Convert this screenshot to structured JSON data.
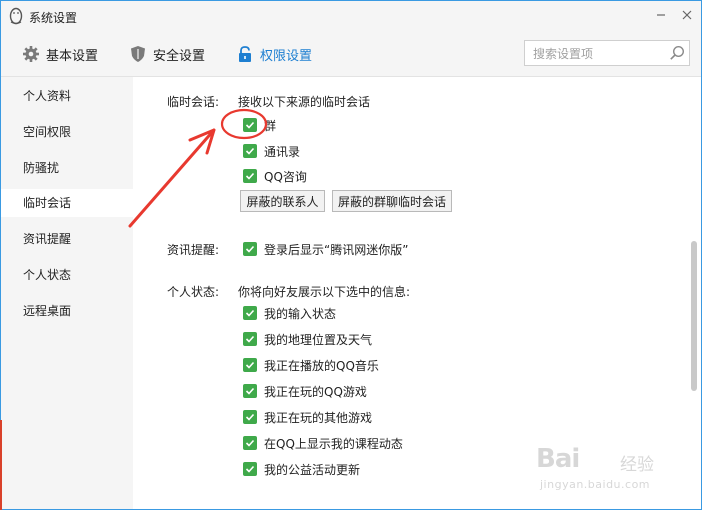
{
  "window": {
    "title": "系统设置",
    "icons": {
      "logo": "penguin-icon",
      "minimize": "minimize-icon",
      "close": "close-icon"
    }
  },
  "toolbar": {
    "tabs": [
      {
        "label": "基本设置",
        "icon": "gear-icon",
        "active": false
      },
      {
        "label": "安全设置",
        "icon": "shield-icon",
        "active": false
      },
      {
        "label": "权限设置",
        "icon": "lock-icon",
        "active": true
      }
    ],
    "search": {
      "placeholder": "搜索设置项",
      "value": "",
      "icon": "search-icon"
    },
    "accent_color": "#1e7fd1"
  },
  "sidebar": {
    "items": [
      {
        "label": "个人资料",
        "active": false
      },
      {
        "label": "空间权限",
        "active": false
      },
      {
        "label": "防骚扰",
        "active": false
      },
      {
        "label": "临时会话",
        "active": true
      },
      {
        "label": "资讯提醒",
        "active": false
      },
      {
        "label": "个人状态",
        "active": false
      },
      {
        "label": "远程桌面",
        "active": false
      }
    ]
  },
  "main": {
    "temp_session": {
      "label": "临时会话:",
      "description": "接收以下来源的临时会话",
      "options": [
        {
          "label": "群",
          "checked": true
        },
        {
          "label": "通讯录",
          "checked": true
        },
        {
          "label": "QQ咨询",
          "checked": true
        }
      ],
      "buttons": [
        "屏蔽的联系人",
        "屏蔽的群聊临时会话"
      ]
    },
    "news": {
      "label": "资讯提醒:",
      "option": {
        "label": "登录后显示“腾讯网迷你版”",
        "checked": true
      }
    },
    "status": {
      "label": "个人状态:",
      "description": "你将向好友展示以下选中的信息:",
      "options": [
        {
          "label": "我的输入状态",
          "checked": true
        },
        {
          "label": "我的地理位置及天气",
          "checked": true
        },
        {
          "label": "我正在播放的QQ音乐",
          "checked": true
        },
        {
          "label": "我正在玩的QQ游戏",
          "checked": true
        },
        {
          "label": "我正在玩的其他游戏",
          "checked": true
        },
        {
          "label": "在QQ上显示我的课程动态",
          "checked": true
        },
        {
          "label": "我的公益活动更新",
          "checked": true
        }
      ]
    },
    "check_color": "#3fa94a"
  },
  "annotation": {
    "color": "#e8392f"
  },
  "watermark": {
    "brand": "Bai",
    "brand2": "经验",
    "url": "jingyan.baidu.com"
  }
}
